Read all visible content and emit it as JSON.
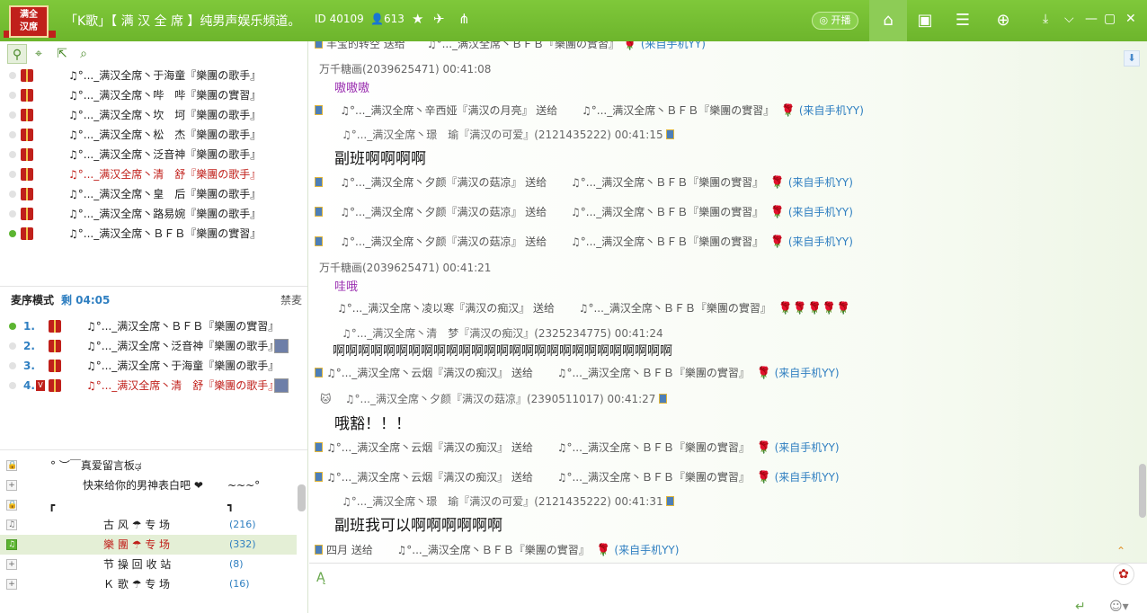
{
  "header": {
    "logo_text": [
      "满",
      "全",
      "汉",
      "席"
    ],
    "title": "「K歌」【 满 汉 全 席 】纯男声娱乐频道。",
    "channel_id": "ID 40109",
    "online_count": "613",
    "live_label": "开播"
  },
  "users": [
    {
      "name": "♫°..._满汉全席丶于海童『樂團の歌手』",
      "color": "black",
      "status": "gray"
    },
    {
      "name": "♫°..._满汉全席丶哔　哔『樂團の實習』",
      "color": "black",
      "status": "gray"
    },
    {
      "name": "♫°..._满汉全席丶坎　坷『樂團の歌手』",
      "color": "black",
      "status": "gray"
    },
    {
      "name": "♫°..._满汉全席丶松　杰『樂團の歌手』",
      "color": "black",
      "status": "gray"
    },
    {
      "name": "♫°..._满汉全席丶泛音神『樂團の歌手』",
      "color": "black",
      "status": "gray"
    },
    {
      "name": "♫°..._满汉全席丶清　舒『樂團の歌手』",
      "color": "red",
      "status": "gray"
    },
    {
      "name": "♫°..._满汉全席丶皇　后『樂團の歌手』",
      "color": "black",
      "status": "gray"
    },
    {
      "name": "♫°..._满汉全席丶路易婉『樂團の歌手』",
      "color": "black",
      "status": "gray"
    },
    {
      "name": "♫°..._满汉全席丶ＢＦＢ『樂團の實習』",
      "color": "black",
      "status": "green"
    }
  ],
  "queue": {
    "mode_label": "麦序模式",
    "remaining": "剩 04:05",
    "ban_label": "禁麦",
    "items": [
      {
        "num": "1.",
        "name": "♫°..._满汉全席丶ＢＦＢ『樂團の實習』",
        "color": "black"
      },
      {
        "num": "2.",
        "name": "♫°..._满汉全席丶泛音神『樂團の歌手』",
        "color": "black"
      },
      {
        "num": "3.",
        "name": "♫°..._满汉全席丶于海童『樂團の歌手』",
        "color": "black"
      },
      {
        "num": "4.",
        "name": "♫°..._满汉全席丶清　舒『樂團の歌手』",
        "color": "red"
      }
    ]
  },
  "channels": [
    {
      "text": "° ︶￣真爱留言板ಢ",
      "count": ""
    },
    {
      "text": "快来给你的男神表白吧 ❤",
      "extra": "~~~°",
      "count": ""
    },
    {
      "text": "┏",
      "extra": "┓",
      "count": ""
    },
    {
      "text": "古 风 ☂ 专 场",
      "count": "(216)"
    },
    {
      "text": "樂 團 ☂ 专 场",
      "count": "(332)"
    },
    {
      "text": "节 操 回 收 站",
      "count": "(8)"
    },
    {
      "text": "Ｋ 歌 ☂ 专 场",
      "count": "(16)"
    }
  ],
  "chat": {
    "top_cut": "丰宝的转空 送给　　♫°..._满汉全席丶ＢＦＢ『樂團の實習』",
    "m1_meta": "万千糖画(2039625471) 00:41:08",
    "m1_text": "嗷嗷嗷",
    "g1_from": "♫°..._满汉全席丶辛西娅『满汉の月亮』 送给",
    "g1_to": "♫°..._满汉全席丶ＢＦＢ『樂團の實習』",
    "mobile": "(来自手机YY)",
    "m2_meta": "♫°..._满汉全席丶璟　瑜『满汉の可爱』(2121435222) 00:41:15",
    "m2_text": "副班啊啊啊啊",
    "g2_from": "♫°..._满汉全席丶夕颜『满汉の菇凉』 送给",
    "g2_to": "♫°..._满汉全席丶ＢＦＢ『樂團の實習』",
    "m3_meta": "万千糖画(2039625471) 00:41:21",
    "m3_text": "哇哦",
    "g5_from": "♫°..._满汉全席丶凌以寒『满汉の痴汉』 送给",
    "g5_to": "♫°..._满汉全席丶ＢＦＢ『樂團の實習』",
    "m4_meta": "♫°..._满汉全席丶清　梦『满汉の痴汉』(2325234775) 00:41:24",
    "m4_text": "啊啊啊啊啊啊啊啊啊啊啊啊啊啊啊啊啊啊啊啊啊啊啊啊啊啊啊",
    "g6_from": "♫°..._满汉全席丶云烟『满汉の痴汉』 送给",
    "g6_to": "♫°..._满汉全席丶ＢＦＢ『樂團の實習』",
    "m5_meta": "♫°..._满汉全席丶夕颜『满汉の菇凉』(2390511017) 00:41:27",
    "m5_text": "哦豁！！！",
    "m6_meta": "♫°..._满汉全席丶璟　瑜『满汉の可爱』(2121435222) 00:41:31",
    "m6_text": "副班我可以啊啊啊啊啊啊",
    "g9_from": "四月 送给",
    "g9_to": "♫°..._满汉全席丶ＢＦＢ『樂團の實習』"
  },
  "colors": {
    "accent": "#6db52c",
    "link": "#2f7fc1",
    "name_red": "#c0201b",
    "purple": "#9a2fb0"
  }
}
